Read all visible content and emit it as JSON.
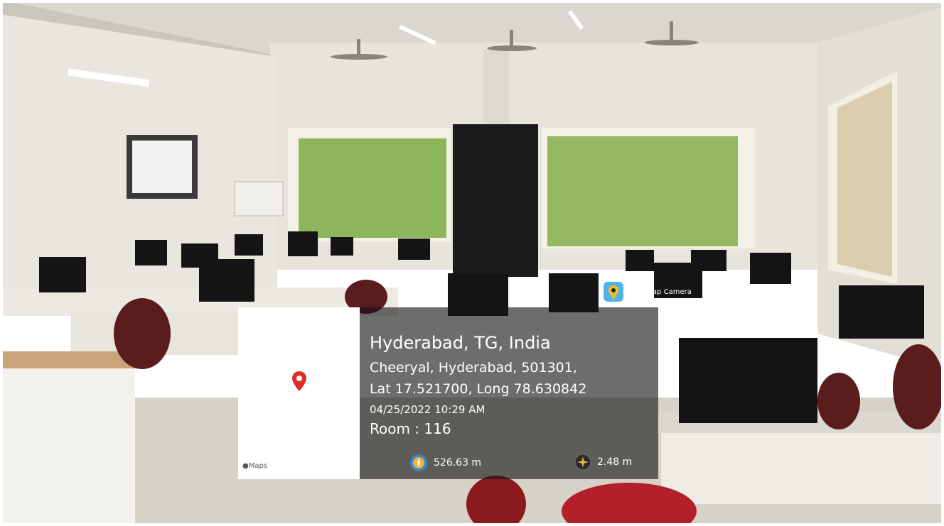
{
  "overlay": {
    "app_badge": "GPS Map Camera",
    "map_label": "Maps",
    "location_title": "Hyderabad, TG, India",
    "address": "Cheeryal, Hyderabad, 501301,",
    "coordinates": "Lat 17.521700, Long 78.630842",
    "datetime": "04/25/2022 10:29 AM",
    "note": "Room : 116",
    "altitude": "526.63 m",
    "accuracy": "2.48 m",
    "icons": [
      "map-pin-icon",
      "apple-icon",
      "gps-map-camera-app-icon",
      "altitude-compass-icon",
      "accuracy-compass-icon"
    ],
    "pin_color": "#e02b2b"
  }
}
